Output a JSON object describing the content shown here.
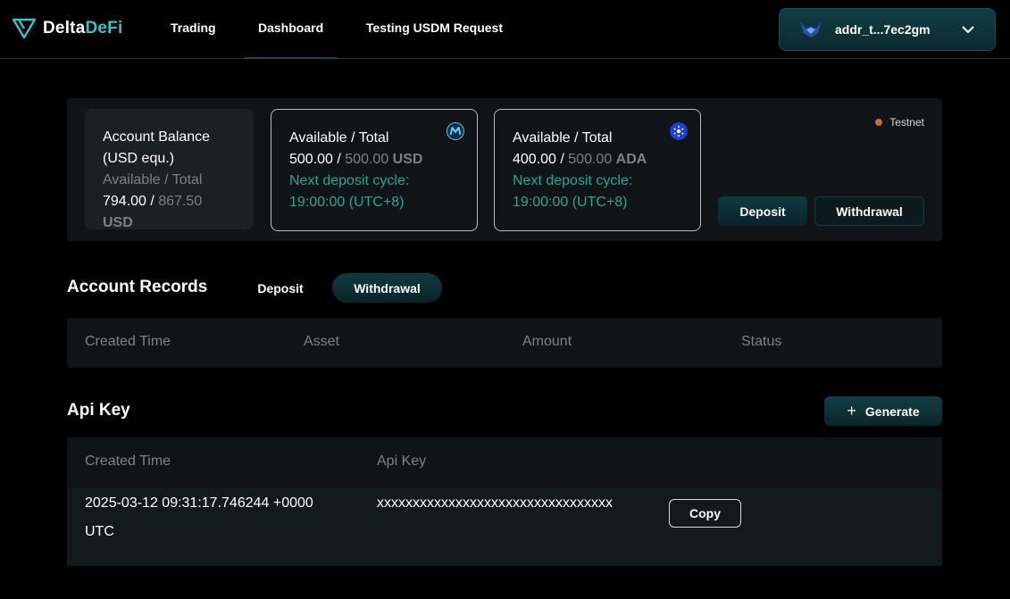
{
  "brand": {
    "part1": "Delta",
    "part2": "DeFi"
  },
  "nav": {
    "trading": "Trading",
    "dashboard": "Dashboard",
    "usdm": "Testing USDM Request"
  },
  "wallet": {
    "address": "addr_t...7ec2gm"
  },
  "balance": {
    "title_line1": "Account Balance",
    "title_line2": "(USD equ.)",
    "sub": "Available / Total",
    "available": "794.00",
    "sep": " / ",
    "total": "867.50",
    "unit": "USD"
  },
  "usdm_card": {
    "title": "Available / Total",
    "available": "500.00",
    "sep": " / ",
    "total": "500.00",
    "unit": "USD",
    "cycle_label": "Next deposit cycle:",
    "cycle_time": "19:00:00 (UTC+8)"
  },
  "ada_card": {
    "title": "Available / Total",
    "available": "400.00",
    "sep": " / ",
    "total": "500.00",
    "unit": "ADA",
    "cycle_label": "Next deposit cycle:",
    "cycle_time": "19:00:00 (UTC+8)"
  },
  "network": {
    "label": "Testnet"
  },
  "actions": {
    "deposit": "Deposit",
    "withdrawal": "Withdrawal"
  },
  "records": {
    "title": "Account Records",
    "tabs": {
      "deposit": "Deposit",
      "withdrawal": "Withdrawal"
    },
    "columns": [
      "Created Time",
      "Asset",
      "Amount",
      "Status"
    ]
  },
  "api": {
    "title": "Api Key",
    "generate": "Generate",
    "columns": [
      "Created Time",
      "Api Key"
    ],
    "rows": [
      {
        "created_line1": "2025-03-12 09:31:17.746244 +0000",
        "created_line2": "UTC",
        "key": "xxxxxxxxxxxxxxxxxxxxxxxxxxxxxxxxx",
        "copy": "Copy"
      }
    ]
  }
}
